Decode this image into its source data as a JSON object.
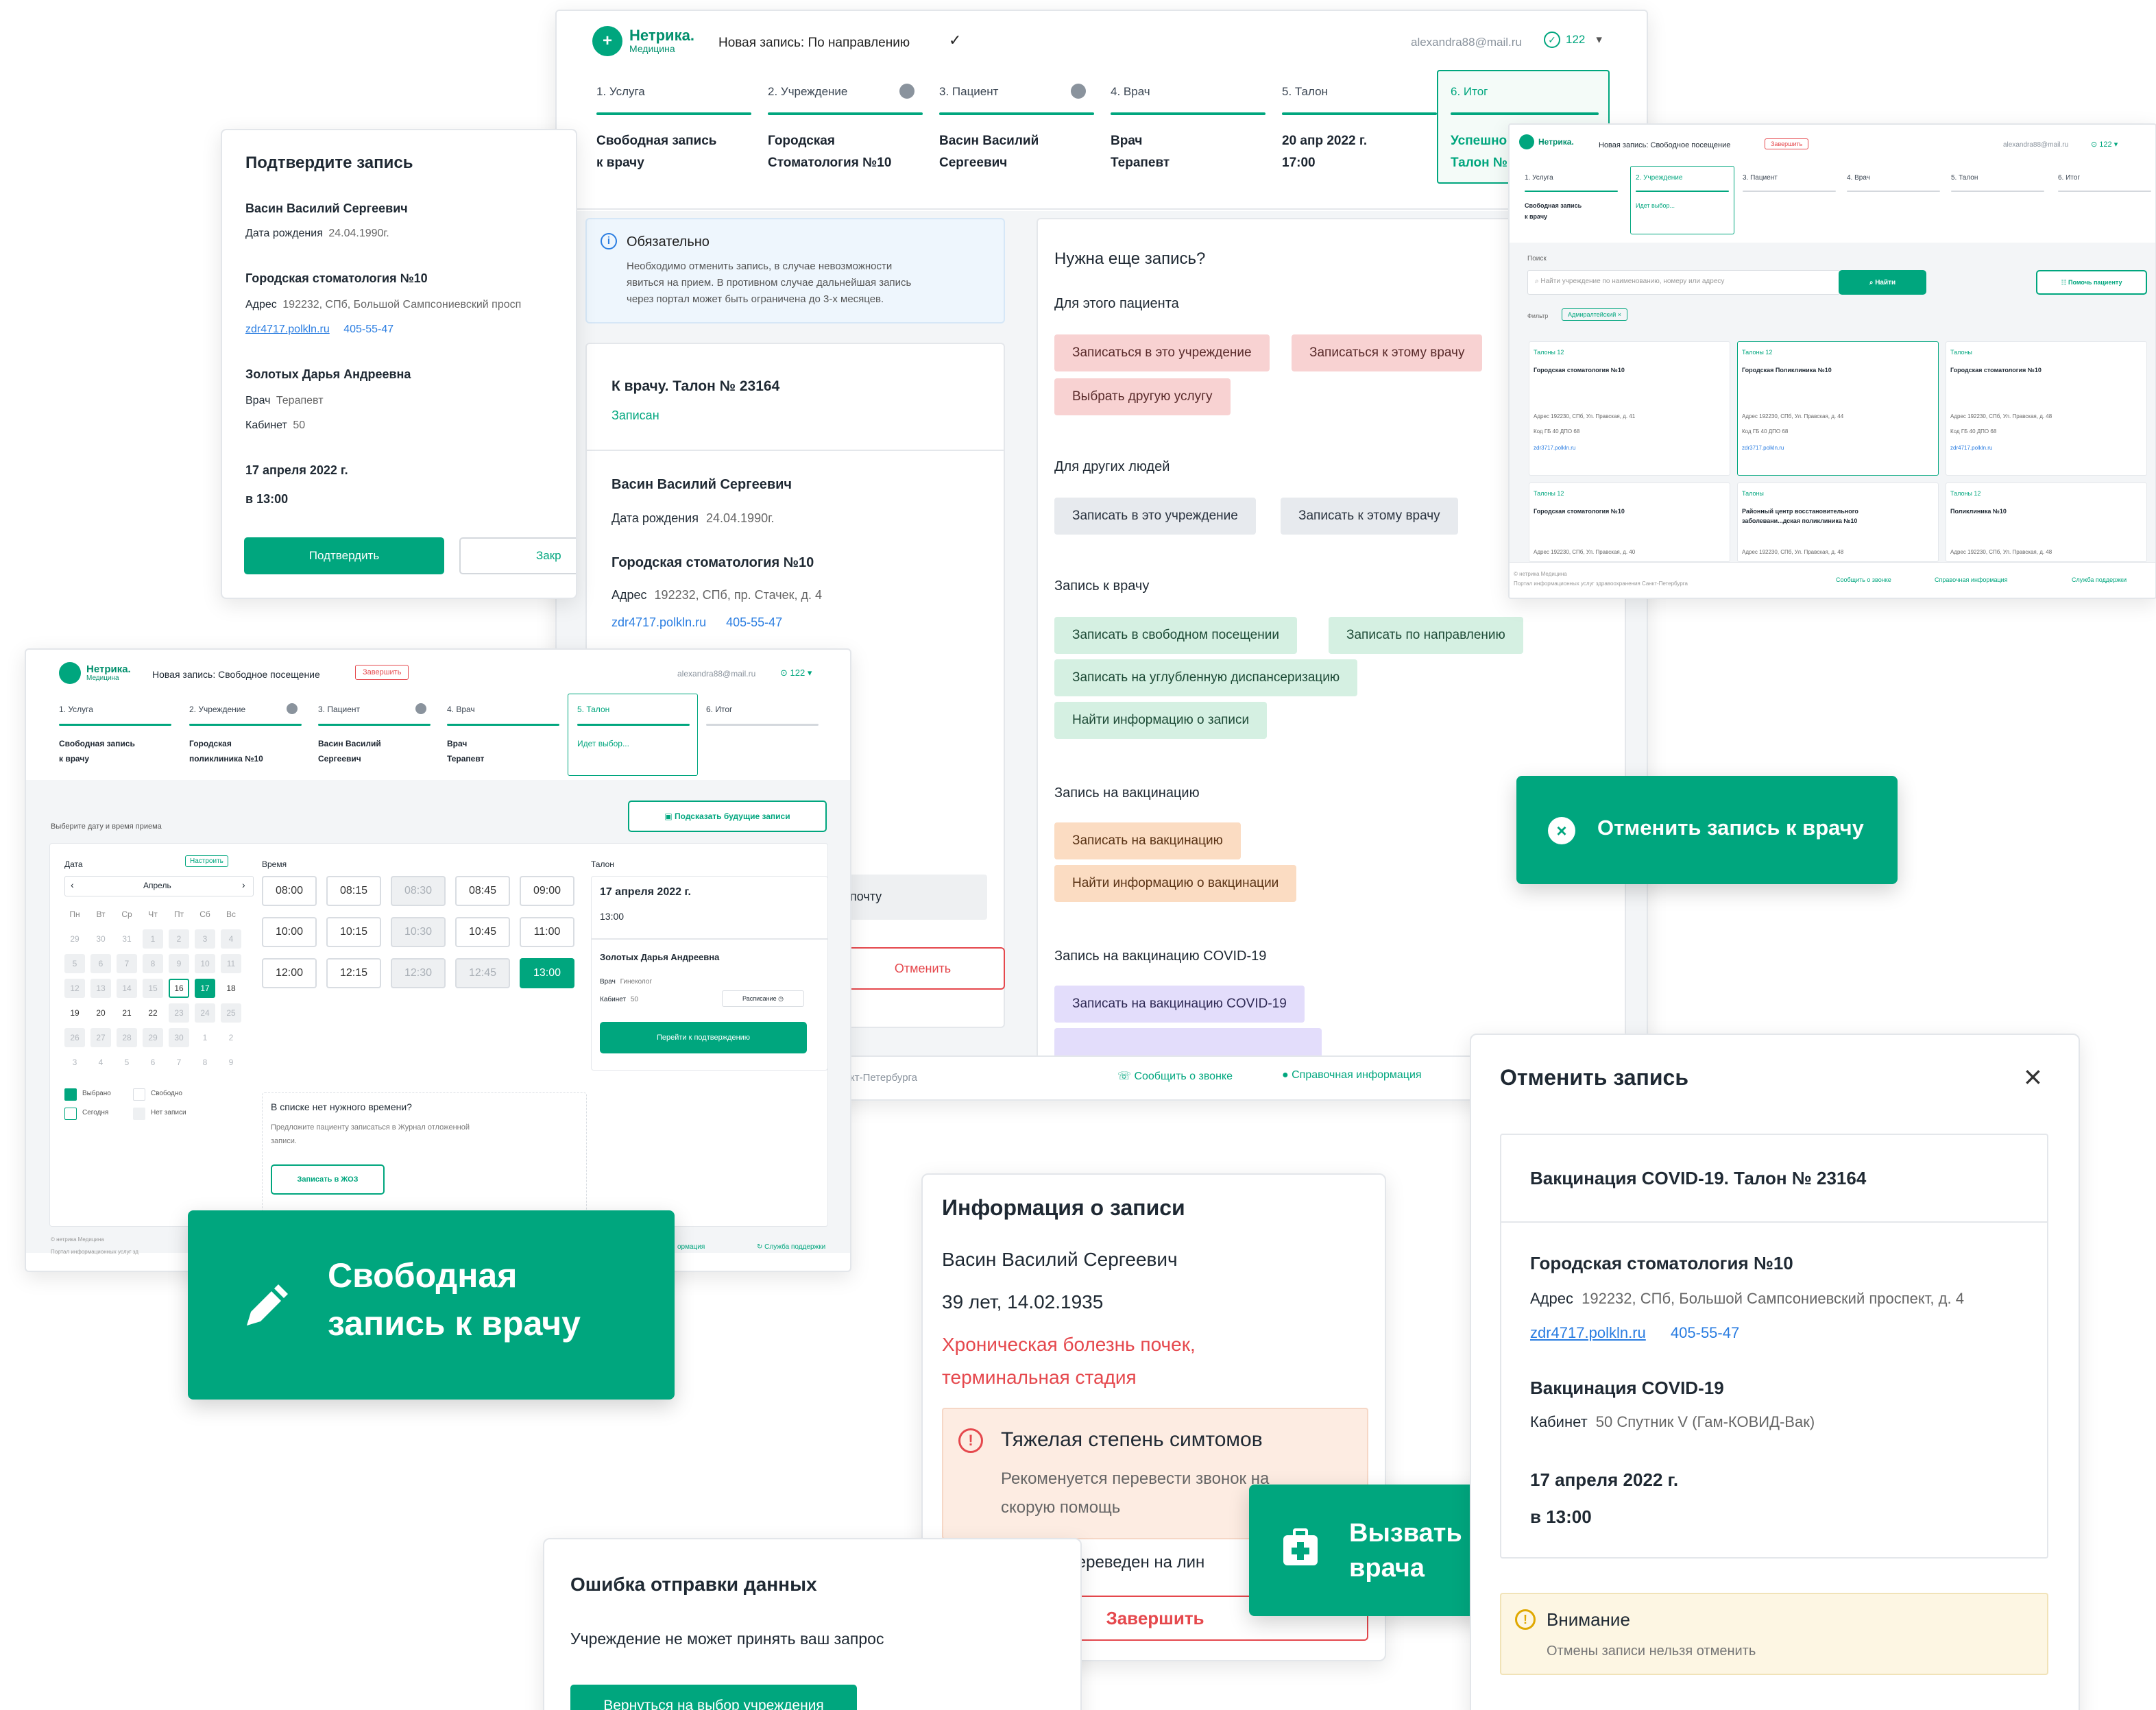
{
  "brand": {
    "name": "Нетрика.",
    "sub": "Медицина"
  },
  "main": {
    "record_title": "Новая запись: По направлению",
    "email": "alexandra88@mail.ru",
    "count": "122",
    "steps": [
      "1. Услуга",
      "2. Учреждение",
      "3. Пациент",
      "4. Врач",
      "5. Талон",
      "6. Итог"
    ],
    "step_values": [
      [
        "Свободная запись",
        "к врачу"
      ],
      [
        "Городская",
        "Стоматология №10"
      ],
      [
        "Васин Василий",
        "Сергеевич"
      ],
      [
        "Врач",
        "Терапевт"
      ],
      [
        "20 апр 2022 г.",
        "17:00"
      ],
      [
        "Успешно",
        "Талон №"
      ]
    ],
    "notice_title": "Обязательно",
    "notice_text_1": "Необходимо отменить запись, в случае невозможности",
    "notice_text_2": "явиться на прием. В противном случае дальнейшая запись",
    "notice_text_3": "через портал может быть ограничена до 3-х месяцев.",
    "ticket_title": "К врачу. Талон № 23164",
    "ticket_status": "Записан",
    "patient_name": "Васин Василий Сергеевич",
    "birth_label": "Дата рождения",
    "birth_value": "24.04.1990г.",
    "clinic_name": "Городская стоматология №10",
    "address_label": "Адрес",
    "address_value": "192232, СПб, пр. Стачек, д. 4",
    "site": "zdr4717.polkln.ru",
    "phone": "405-55-47",
    "email_partial": "почту",
    "cancel_btn": "Отменить",
    "more_title": "Нужна еще запись?",
    "this_patient": "Для этого пациента",
    "btn_inst": "Записаться в это учреждение",
    "btn_doc": "Записаться к этому врачу",
    "btn_service": "Выбрать другую услугу",
    "other_people": "Для других людей",
    "btn_inst2": "Записать в это учреждение",
    "btn_doc2": "Записать к этому врачу",
    "doctor_section": "Запись к врачу",
    "btn_free": "Записать в свободном посещении",
    "btn_ref": "Записать по направлению",
    "btn_disp": "Записать на углубленную диспансеризацию",
    "btn_find": "Найти информацию о записи",
    "vac_section": "Запись на вакцинацию",
    "btn_vac": "Записать на вакцинацию",
    "btn_vac_info": "Найти информацию о вакцинации",
    "covid_section": "Запись на вакцинацию COVID-19",
    "btn_covid": "Записать на вакцинацию COVID-19",
    "footer_partial": "кт-Петербурга",
    "footer_call": "Сообщить о звонке",
    "footer_info": "Справочная информация"
  },
  "confirm": {
    "title": "Подтвердите запись",
    "patient": "Васин Василий Сергеевич",
    "birth_label": "Дата рождения",
    "birth_value": "24.04.1990г.",
    "clinic": "Городская стоматология №10",
    "address_label": "Адрес",
    "address_value": "192232, СПб, Большой Сампсониевский просп",
    "site": "zdr4717.polkln.ru",
    "phone": "405-55-47",
    "doctor": "Золотых Дарья Андреевна",
    "spec_label": "Врач",
    "spec_value": "Терапевт",
    "room_label": "Кабинет",
    "room_value": "50",
    "date": "17 апреля 2022 г.",
    "time": "в 13:00",
    "confirm_btn": "Подтвердить",
    "close_btn": "Закр"
  },
  "inst": {
    "title": "Новая запись: Свободное посещение",
    "badge": "Завершить",
    "email": "alexandra88@mail.ru",
    "count": "122",
    "steps": [
      "1. Услуга",
      "2. Учреждение",
      "3. Пациент",
      "4. Врач",
      "5. Талон",
      "6. Итог"
    ],
    "step_values": [
      [
        "Свободная запись",
        "к врачу"
      ],
      [
        "Идет выбор..."
      ]
    ],
    "search_label": "Поиск",
    "search_placeholder": "Найти учреждение по наименованию, номеру или адресу",
    "search_btn": "Найти",
    "help_btn": "Помочь пациенту",
    "filter_label": "Фильтр",
    "filter_tag": "Адмиралтейский",
    "cards": [
      {
        "tickets": "Талоны 12",
        "name": "Городская стоматология №10",
        "addr": "Адрес 192230, СПб, Ул. Правская, д. 41",
        "code": "Код ГБ 40 ДПО 68",
        "site": "zdr3717.polkln.ru"
      },
      {
        "tickets": "Талоны 12",
        "name": "Городская Поликлиника №10",
        "addr": "Адрес 192230, СПб, Ул. Правская, д. 44",
        "code": "Код ГБ 40 ДПО 68",
        "site": "zdr3717.polkln.ru"
      },
      {
        "tickets": "Талоны",
        "name": "Городская стоматология №10",
        "addr": "Адрес 192230, СПб, Ул. Правская, д. 48",
        "code": "Код ГБ 40 ДПО 68",
        "site": "zdr4717.polkln.ru"
      },
      {
        "tickets": "Талоны 12",
        "name": "Городская стоматология №10",
        "addr": "Адрес 192230, СПб, Ул. Правская, д. 40"
      },
      {
        "tickets": "Талоны",
        "name": "Районный центр восстановительного",
        "name2": "заболевани...дская поликлиника №10",
        "addr": "Адрес 192230, СПб, Ул. Правская, д. 48"
      },
      {
        "tickets": "Талоны 12",
        "name": "Поликлиника №10",
        "addr": "Адрес 192230, СПб, Ул. Правская, д. 48"
      }
    ],
    "footer_1": "© нетрика Медицина",
    "footer_2": "Портал информационных услуг здравоохранения Санкт-Петербурга",
    "footer_call": "Сообщить о звонке",
    "footer_info": "Справочная информация",
    "footer_support": "Служба поддержки"
  },
  "sched": {
    "title": "Новая запись: Свободное посещение",
    "badge": "Завершить",
    "email": "alexandra88@mail.ru",
    "count": "122",
    "steps": [
      "1. Услуга",
      "2. Учреждение",
      "3. Пациент",
      "4. Врач",
      "5. Талон",
      "6. Итог"
    ],
    "step_values": [
      [
        "Свободная запись",
        "к врачу"
      ],
      [
        "Городская",
        "поликлиника №10"
      ],
      [
        "Васин Василий",
        "Сергеевич"
      ],
      [
        "Врач",
        "Терапевт"
      ],
      [
        "Идет выбор..."
      ]
    ],
    "hint_btn": "Подсказать будущие записи",
    "choose": "Выберите дату и время приема",
    "date_label": "Дата",
    "setup": "Настроить",
    "month": "Апрель",
    "weekdays": [
      "Пн",
      "Вт",
      "Ср",
      "Чт",
      "Пт",
      "Сб",
      "Вс"
    ],
    "days": [
      [
        "29",
        "30",
        "31",
        "1",
        "2",
        "3",
        "4"
      ],
      [
        "5",
        "6",
        "7",
        "8",
        "9",
        "10",
        "11"
      ],
      [
        "12",
        "13",
        "14",
        "15",
        "16",
        "17",
        "18"
      ],
      [
        "19",
        "20",
        "21",
        "22",
        "23",
        "24",
        "25"
      ],
      [
        "26",
        "27",
        "28",
        "29",
        "30",
        "1",
        "2"
      ],
      [
        "3",
        "4",
        "5",
        "6",
        "7",
        "8",
        "9"
      ]
    ],
    "time_label": "Время",
    "times": [
      [
        "08:00",
        "08:15",
        "08:30",
        "08:45",
        "09:00"
      ],
      [
        "10:00",
        "10:15",
        "10:30",
        "10:45",
        "11:00"
      ],
      [
        "12:00",
        "12:15",
        "12:30",
        "12:45",
        "13:00"
      ]
    ],
    "ticket_label": "Талон",
    "ticket_date": "17 апреля 2022 г.",
    "ticket_time": "13:00",
    "ticket_doctor": "Золотых Дарья Андреевна",
    "ticket_spec_l": "Врач",
    "ticket_spec_v": "Гинеколог",
    "ticket_room_l": "Кабинет",
    "ticket_room_v": "50",
    "schedule_btn": "Расписание",
    "go_confirm": "Перейти к подтверждению",
    "legend": [
      "Выбрано",
      "Свободно",
      "Сегодня",
      "Нет записи"
    ],
    "no_time": "В списке нет нужного времени?",
    "no_time_text_1": "Предложите пациенту записаться в Журнал отложенной",
    "no_time_text_2": "записи.",
    "jzo_btn": "Записать в ЖОЗ",
    "footer_1": "© нетрика Медицина",
    "footer_2": "Портал информационных услуг зд",
    "footer_info": "ормация",
    "footer_support": "Служба поддержки"
  },
  "tile_free": "Свободная запись к врачу",
  "tile_cancel": "Отменить запись к врачу",
  "tile_doctor": "Вызвать врача",
  "info": {
    "title": "Информация о записи",
    "patient": "Васин Василий Сергеевич",
    "age": "39 лет, 14.02.1935",
    "diagnosis_1": "Хроническая болезнь почек,",
    "diagnosis_2": "терминальная стадия",
    "severity": "Тяжелая степень симтомов",
    "recommend_1": "Рекоменуется перевести звонок на",
    "recommend_2": "скорую помощь",
    "checkbox": "Звонок был переведен на лин",
    "finish": "Завершить"
  },
  "cancel": {
    "title": "Отменить запись",
    "ticket": "Вакцинация COVID-19. Талон № 23164",
    "clinic": "Городская стоматология №10",
    "address_label": "Адрес",
    "address_value": "192232, СПб, Большой Сампсониевский проспект, д. 4",
    "site": "zdr4717.polkln.ru",
    "phone": "405-55-47",
    "vac": "Вакцинация COVID-19",
    "room_label": "Кабинет",
    "room_value": "50 Спутник V (Гам-КОВИД-Вак)",
    "date": "17 апреля 2022 г.",
    "time": "в 13:00",
    "warn_title": "Внимание",
    "warn_text": "Отмены записи нельзя отменить"
  },
  "error": {
    "title": "Ошибка отправки данных",
    "text": "Учреждение не может принять ваш запрос",
    "btn": "Вернуться на выбор учреждения"
  },
  "colors": {
    "accent": "#00a67e",
    "danger": "#e5484d"
  }
}
